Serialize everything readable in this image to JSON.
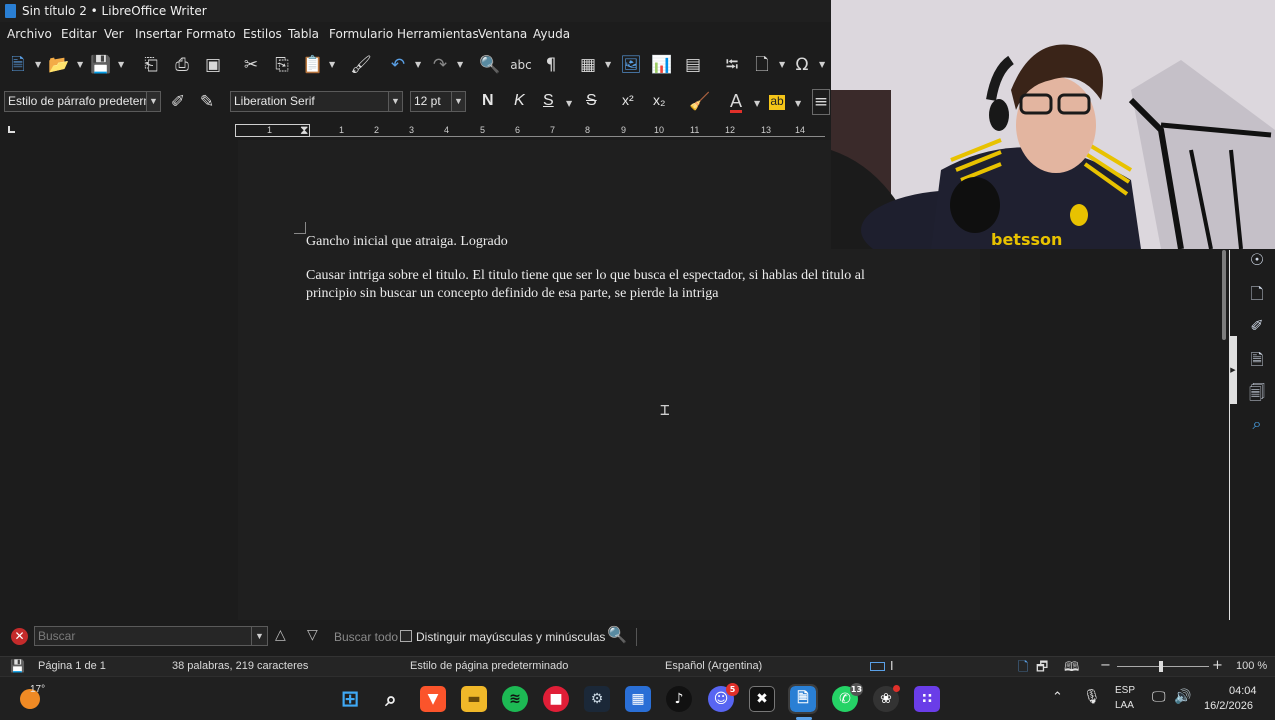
{
  "window": {
    "title": "Sin título 2 • LibreOffice Writer"
  },
  "menu": [
    "Archivo",
    "Editar",
    "Ver",
    "Insertar",
    "Formato",
    "Estilos",
    "Tabla",
    "Formulario",
    "Herramientas",
    "Ventana",
    "Ayuda"
  ],
  "formatting": {
    "paragraph_style": "Estilo de párrafo predetermin",
    "font_name": "Liberation Serif",
    "font_size": "12 pt",
    "bold": "N",
    "italic": "K",
    "underline": "S",
    "strike": "S",
    "superscript": "x²",
    "subscript": "x₂"
  },
  "ruler_ticks": [
    "1",
    "1",
    "2",
    "3",
    "4",
    "5",
    "6",
    "7",
    "8",
    "9",
    "10",
    "11",
    "12",
    "13",
    "14"
  ],
  "document": {
    "paragraphs": [
      "Gancho inicial que atraiga. Logrado",
      "Causar intriga sobre el titulo. El titulo tiene que ser lo que busca el espectador, si hablas del titulo al",
      "principio sin buscar un concepto definido de esa parte, se pierde la intriga"
    ]
  },
  "findbar": {
    "placeholder": "Buscar",
    "find_all": "Buscar todo",
    "match_case": "Distinguir mayúsculas y minúsculas"
  },
  "status": {
    "page": "Página 1 de 1",
    "counts": "38 palabras, 219 caracteres",
    "page_style": "Estilo de página predeterminado",
    "language": "Español (Argentina)",
    "zoom": "100 %"
  },
  "taskbar": {
    "weather_temp": "17°",
    "discord_badge": "5",
    "whatsapp_badge": "13",
    "lang_line1": "ESP",
    "lang_line2": "LAA",
    "time": "04:04",
    "date": "16/2/2026"
  },
  "colors": {
    "accent": "#2a7fd4",
    "font_color": "#e0302a",
    "highlight": "#f5c518"
  }
}
